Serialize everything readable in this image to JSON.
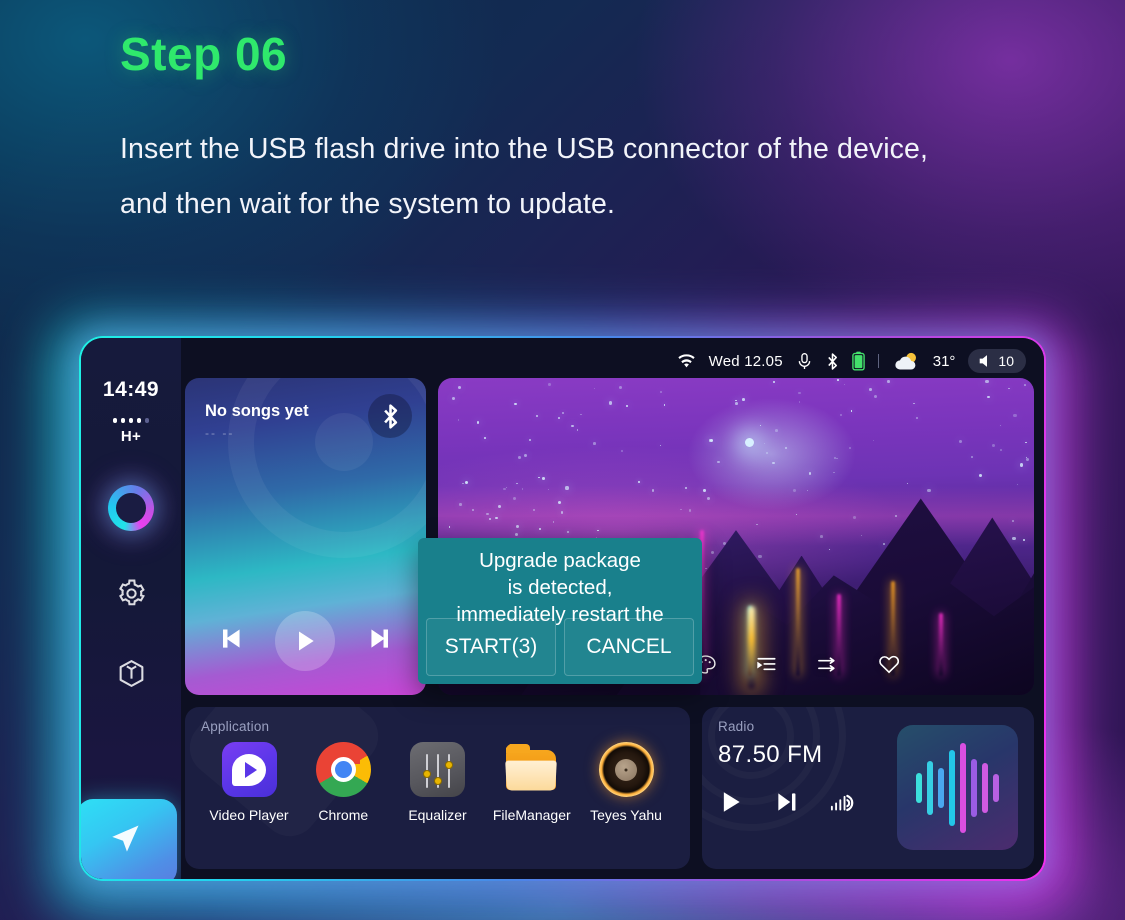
{
  "header": {
    "step_title": "Step 06",
    "description": "Insert the USB flash drive into the USB connector of the device, and then wait for the system to update.",
    "accent_color": "#2fe96c"
  },
  "device": {
    "frame_gradient_start": "#1ff0e4",
    "frame_gradient_end": "#f22ff0",
    "sidebar": {
      "time": "14:49",
      "signal_dots_filled": 4,
      "signal_dots_total": 5,
      "network_type": "H+",
      "items": [
        {
          "name": "assistant-ring",
          "label": ""
        },
        {
          "name": "settings",
          "label": ""
        },
        {
          "name": "apps-cube",
          "label": ""
        }
      ],
      "nav_button_icon": "navigation-send-icon"
    },
    "statusbar": {
      "wifi_icon": "wifi-icon",
      "date": "Wed 12.05",
      "mic_icon": "microphone-icon",
      "bluetooth_icon": "bluetooth-icon",
      "battery_icon": "battery-icon",
      "weather_icon": "sun-cloud-icon",
      "temperature": "31°",
      "volume_icon": "speaker-icon",
      "volume_level": "10"
    },
    "music_card": {
      "title": "No songs yet",
      "subtitle": "-- --",
      "bluetooth_icon": "bluetooth-icon",
      "controls": [
        {
          "name": "previous",
          "icon": "skip-previous-icon"
        },
        {
          "name": "play",
          "icon": "play-icon"
        },
        {
          "name": "next",
          "icon": "skip-next-icon"
        }
      ]
    },
    "video_card": {
      "controls": [
        {
          "name": "pause",
          "icon": "pause-icon"
        },
        {
          "name": "next",
          "icon": "skip-next-icon"
        },
        {
          "name": "theme",
          "icon": "palette-icon"
        },
        {
          "name": "playlist",
          "icon": "playlist-icon"
        },
        {
          "name": "shuffle",
          "icon": "shuffle-icon"
        },
        {
          "name": "favorite",
          "icon": "heart-icon"
        }
      ]
    },
    "app_card": {
      "label": "Application",
      "apps": [
        {
          "name": "Video Player",
          "icon": "video-player-icon"
        },
        {
          "name": "Chrome",
          "icon": "chrome-icon"
        },
        {
          "name": "Equalizer",
          "icon": "equalizer-icon"
        },
        {
          "name": "FileManager",
          "icon": "folder-icon"
        },
        {
          "name": "Teyes Yahu",
          "icon": "teyes-yahu-icon"
        }
      ]
    },
    "radio_card": {
      "label": "Radio",
      "frequency": "87.50 FM",
      "controls": [
        {
          "name": "play",
          "icon": "play-icon"
        },
        {
          "name": "next",
          "icon": "skip-next-icon"
        },
        {
          "name": "band",
          "icon": "soundwave-icon"
        }
      ]
    },
    "dialog": {
      "message": "Upgrade package\nis detected,\nimmediately restart the",
      "start_label": "START(3)",
      "cancel_label": "CANCEL",
      "background_color": "#19808c"
    }
  }
}
